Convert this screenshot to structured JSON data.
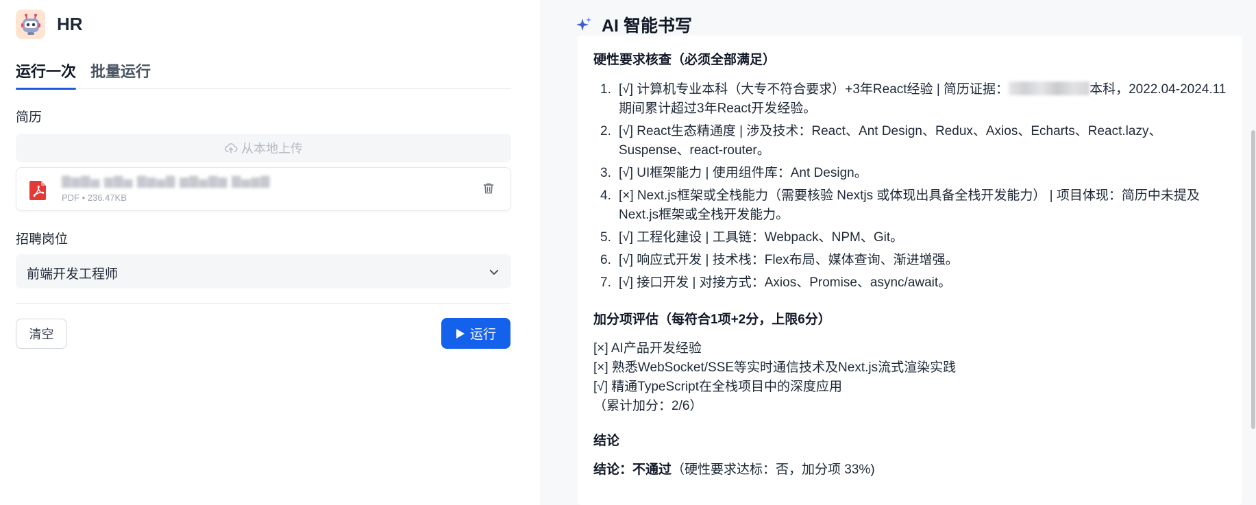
{
  "app": {
    "title": "HR"
  },
  "tabs": [
    {
      "label": "运行一次",
      "active": true
    },
    {
      "label": "批量运行",
      "active": false
    }
  ],
  "form": {
    "resume_label": "简历",
    "upload_label": "从本地上传",
    "file": {
      "meta": "PDF • 236.47KB"
    },
    "position_label": "招聘岗位",
    "position_value": "前端开发工程师",
    "clear_label": "清空",
    "run_label": "运行"
  },
  "result": {
    "header": "AI 智能书写",
    "hard_title": "硬性要求核查（必须全部满足）",
    "hard_items": [
      {
        "num": "1.",
        "text_before": "[√] 计算机专业本科（大专不符合要求）+3年React经验 | 简历证据：",
        "text_after": "本科，2022.04-2024.11期间累计超过3年React开发经验。"
      },
      {
        "num": "2.",
        "text": "[√] React生态精通度 | 涉及技术：React、Ant Design、Redux、Axios、Echarts、React.lazy、Suspense、react-router。"
      },
      {
        "num": "3.",
        "text": "[√] UI框架能力 | 使用组件库：Ant Design。"
      },
      {
        "num": "4.",
        "text": "[×] Next.js框架或全栈能力（需要核验 Nextjs 或体现出具备全栈开发能力） | 项目体现：简历中未提及Next.js框架或全栈开发能力。"
      },
      {
        "num": "5.",
        "text": "[√] 工程化建设 | 工具链：Webpack、NPM、Git。"
      },
      {
        "num": "6.",
        "text": "[√] 响应式开发 | 技术栈：Flex布局、媒体查询、渐进增强。"
      },
      {
        "num": "7.",
        "text": "[√] 接口开发 | 对接方式：Axios、Promise、async/await。"
      }
    ],
    "bonus_title": "加分项评估（每符合1项+2分，上限6分）",
    "bonus_items": [
      "[×] AI产品开发经验",
      "[×] 熟悉WebSocket/SSE等实时通信技术及Next.js流式渲染实践",
      "[√] 精通TypeScript在全栈项目中的深度应用",
      "（累计加分：2/6）"
    ],
    "conclusion_title": "结论",
    "conclusion_label": "结论：不通过",
    "conclusion_detail": "（硬性要求达标：否，加分项 33%)"
  },
  "colors": {
    "accent": "#1461eb",
    "tab_underline": "#1d5bd8",
    "pdf_red": "#e53935",
    "sparkle": "#3b5bdb"
  },
  "icons": [
    "robot-avatar-icon",
    "upload-cloud-icon",
    "pdf-file-icon",
    "trash-icon",
    "chevron-down-icon",
    "play-icon",
    "sparkle-icon"
  ]
}
